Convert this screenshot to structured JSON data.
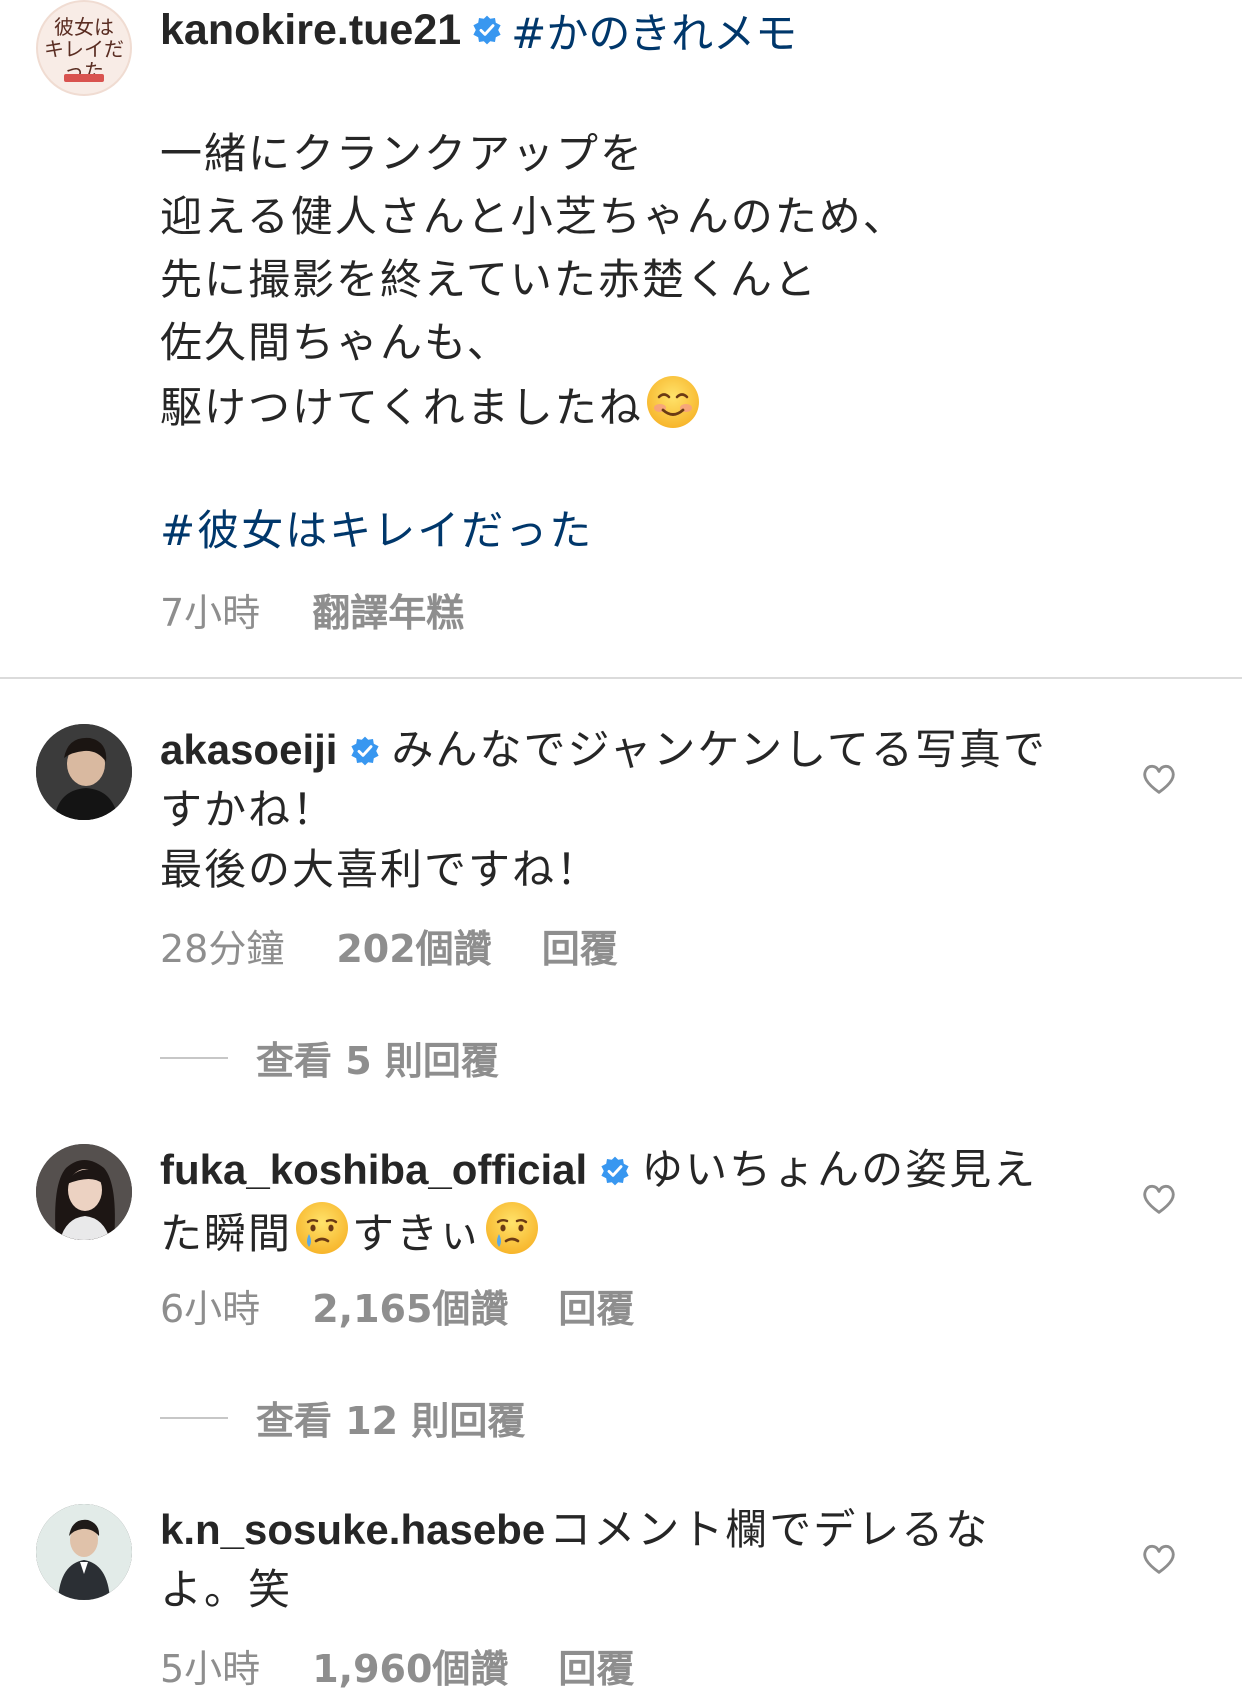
{
  "caption": {
    "username": "kanokire.tue21",
    "header_hashtag": "#かのきれメモ",
    "avatar_logo_text": "彼女は\nキレイだった",
    "body_lines": [
      "一緒にクランクアップを",
      "迎える健人さんと小芝ちゃんのため、",
      "先に撮影を終えていた赤楚くんと",
      "佐久間ちゃんも、",
      "駆けつけてくれましたね"
    ],
    "body_emoji": "smiling-face-emoji",
    "hashtag": "#彼女はキレイだった",
    "time": "7小時",
    "translate": "翻譯年糕"
  },
  "comments": [
    {
      "username": "akasoeiji",
      "verified": true,
      "text": "みんなでジャンケンしてる写真ですかね！\n最後の大喜利ですね！",
      "time": "28分鐘",
      "likes": "202個讚",
      "reply": "回覆",
      "view_replies": "查看 5 則回覆"
    },
    {
      "username": "fuka_koshiba_official",
      "verified": true,
      "text_part1": "ゆいちょんの姿見えた瞬間",
      "text_part2": "すきぃ",
      "emoji": "crying-face-emoji",
      "time": "6小時",
      "likes": "2,165個讚",
      "reply": "回覆",
      "view_replies": "查看 12 則回覆"
    },
    {
      "username": "k.n_sosuke.hasebe",
      "verified": false,
      "text": "コメント欄でデレるなよ。笑",
      "time": "5小時",
      "likes": "1,960個讚",
      "reply": "回覆"
    }
  ],
  "colors": {
    "text": "#262626",
    "secondary": "#8e8e8e",
    "hashtag": "#00376b",
    "verified": "#3897f0",
    "divider": "#dbdbdb"
  }
}
